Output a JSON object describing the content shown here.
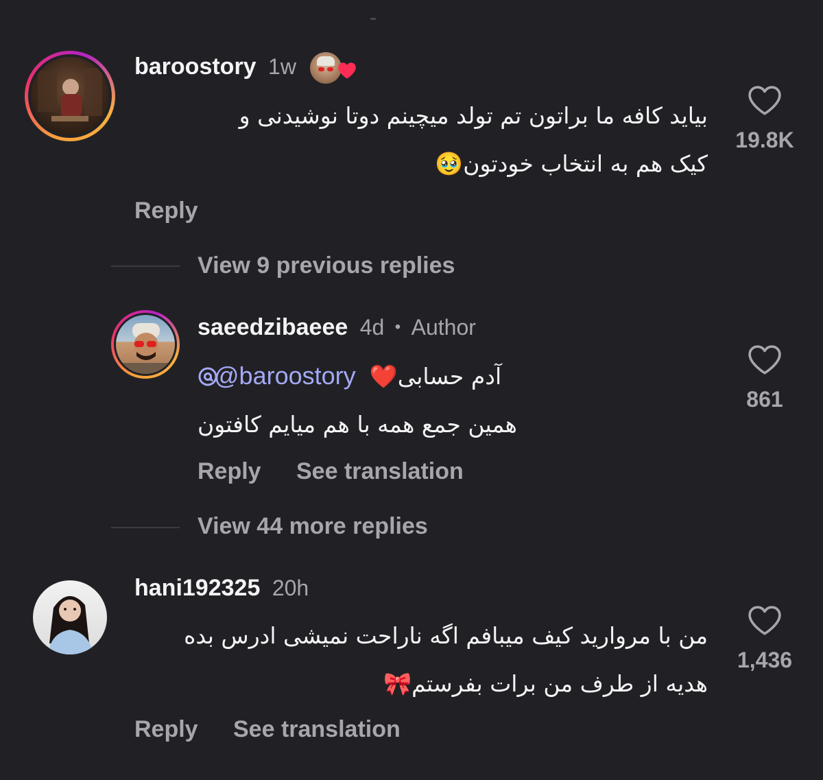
{
  "colors": {
    "background": "#212125",
    "text": "#f4f4f6",
    "secondary": "#a6a6ad",
    "mention": "#a4a9f5",
    "heart_red": "#ff2d55"
  },
  "comments": [
    {
      "username": "baroostory",
      "time": "1w",
      "liked_by_author": true,
      "text_lines": [
        "بیاید کافه ما براتون تم تولد میچینم دوتا نوشیدنی و",
        "کیک هم به انتخاب خودتون🥹"
      ],
      "reply_label": "Reply",
      "like_count": "19.8K",
      "like_icon": "heart-outline-icon"
    },
    {
      "username": "saeedzibaeee",
      "time": "4d",
      "separator": "•",
      "badge": "Author",
      "mention": "@baroostory",
      "text_line1": "آدم حسابی❤️",
      "text_line2": "همین جمع همه با هم میایم کافتون",
      "reply_label": "Reply",
      "translation_label": "See translation",
      "like_count": "861",
      "like_icon": "heart-outline-icon"
    },
    {
      "username": "hani192325",
      "time": "20h",
      "text_lines": [
        "من با مروارید کیف میبافم اگه ناراحت نمیشی ادرس بده",
        "هدیه از طرف من برات بفرستم🎀"
      ],
      "reply_label": "Reply",
      "translation_label": "See translation",
      "like_count": "1,436",
      "like_icon": "heart-outline-icon"
    }
  ],
  "thread": {
    "view_previous": "View 9 previous replies",
    "view_more": "View 44 more replies"
  }
}
